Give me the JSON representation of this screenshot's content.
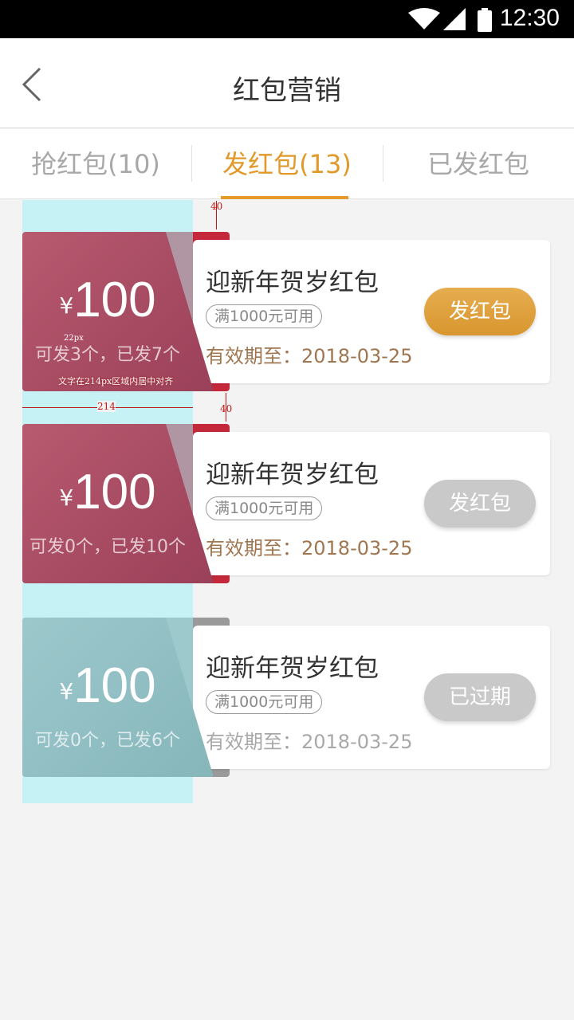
{
  "status_bar": {
    "time": "12:30"
  },
  "header": {
    "title": "红包营销"
  },
  "tabs": [
    {
      "label": "抢红包(10)",
      "active": false
    },
    {
      "label": "发红包(13)",
      "active": true
    },
    {
      "label": "已发红包",
      "active": false
    }
  ],
  "annotations": {
    "gap_top": "40",
    "gap_between": "40",
    "width_label": "214",
    "font_size": "22px",
    "center_note": "文字在214px区域内居中对齐"
  },
  "cards": [
    {
      "currency": "¥",
      "amount": "100",
      "counts": "可发3个，已发7个",
      "title": "迎新年贺岁红包",
      "condition": "满1000元可用",
      "expiry": "有效期至：2018-03-25",
      "button": "发红包",
      "state": "active"
    },
    {
      "currency": "¥",
      "amount": "100",
      "counts": "可发0个，已发10个",
      "title": "迎新年贺岁红包",
      "condition": "满1000元可用",
      "expiry": "有效期至：2018-03-25",
      "button": "发红包",
      "state": "depleted"
    },
    {
      "currency": "¥",
      "amount": "100",
      "counts": "可发0个，已发6个",
      "title": "迎新年贺岁红包",
      "condition": "满1000元可用",
      "expiry": "有效期至：2018-03-25",
      "button": "已过期",
      "state": "expired"
    }
  ],
  "colors": {
    "accent": "#e19a2a",
    "button_active": "#e0a444",
    "button_disabled": "#c9c9c9",
    "coupon_red": "#a84a60",
    "coupon_red_back": "#c4283a",
    "coupon_expired": "#8fbfc3",
    "coupon_expired_back": "#9a9a9a"
  }
}
